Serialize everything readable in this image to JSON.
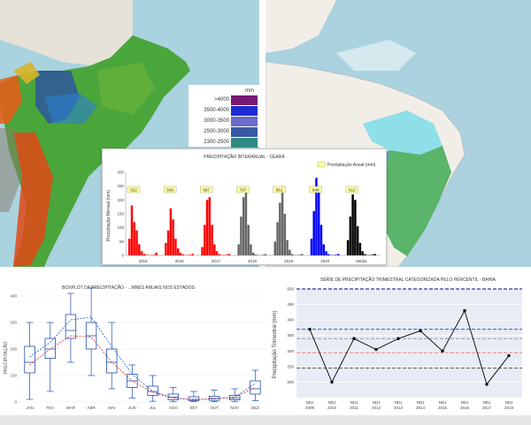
{
  "map_left": {
    "legend_unit": "mm",
    "legend": [
      {
        "label": ">4000",
        "color": "#7a1a73"
      },
      {
        "label": "3500-4000",
        "color": "#1d2bd1"
      },
      {
        "label": "3000-3500",
        "color": "#6a6ccc"
      },
      {
        "label": "2500-3000",
        "color": "#3a59a5"
      },
      {
        "label": "2300-2500",
        "color": "#2e8a80"
      }
    ]
  },
  "chart_data": [
    {
      "type": "bar",
      "title": "PRECIPITAÇÃO INTERANUAL - CEARÁ",
      "ylabel": "Precipitação Mensal (mm)",
      "legend": "Precipitação Anual (mm)",
      "ylim": [
        0,
        300
      ],
      "yticks": [
        0,
        50,
        100,
        150,
        200,
        250,
        300
      ],
      "groups": [
        {
          "label": "2016",
          "annual": "522",
          "color": "#ff0000",
          "values": [
            60,
            180,
            120,
            90,
            40,
            15,
            5,
            2,
            1,
            1,
            2,
            10
          ]
        },
        {
          "label": "2016",
          "annual": "549",
          "color": "#ff0000",
          "values": [
            45,
            90,
            170,
            130,
            60,
            25,
            10,
            3,
            1,
            1,
            2,
            5
          ]
        },
        {
          "label": "2017",
          "annual": "667",
          "color": "#ff0000",
          "values": [
            30,
            110,
            200,
            210,
            110,
            40,
            15,
            4,
            1,
            1,
            2,
            5
          ]
        },
        {
          "label": "2018",
          "annual": "797",
          "color": "#666666",
          "values": [
            40,
            140,
            210,
            240,
            110,
            40,
            10,
            3,
            1,
            1,
            2,
            5
          ]
        },
        {
          "label": "2019",
          "annual": "861",
          "color": "#666666",
          "values": [
            50,
            120,
            190,
            250,
            150,
            55,
            20,
            5,
            1,
            1,
            2,
            5
          ]
        },
        {
          "label": "2020",
          "annual": "849",
          "color": "#0000ff",
          "values": [
            60,
            160,
            280,
            230,
            110,
            40,
            15,
            4,
            1,
            1,
            2,
            5
          ]
        },
        {
          "label": "Média",
          "annual": "812",
          "color": "#000000",
          "values": [
            55,
            140,
            220,
            200,
            105,
            45,
            15,
            4,
            1,
            1,
            2,
            5
          ]
        }
      ]
    },
    {
      "type": "box",
      "title": "BOXPLOT DA PRECIPITAÇÃO - ...MNES ANUAIS NOS ESTADOS",
      "ylabel": "PRECIPITAÇÃO",
      "ylim": [
        0,
        400
      ],
      "yticks": [
        0,
        100,
        200,
        300,
        400
      ],
      "categories": [
        "JAN",
        "FEV",
        "MAR",
        "ABR",
        "MAI",
        "JUN",
        "JUL",
        "AGO",
        "SET",
        "OUT",
        "NOV",
        "DEZ"
      ],
      "boxes": [
        {
          "min": 10,
          "q1": 110,
          "median": 150,
          "q3": 210,
          "max": 300
        },
        {
          "min": 40,
          "q1": 165,
          "median": 200,
          "q3": 240,
          "max": 300
        },
        {
          "min": 150,
          "q1": 240,
          "median": 270,
          "q3": 330,
          "max": 410
        },
        {
          "min": 100,
          "q1": 200,
          "median": 250,
          "q3": 300,
          "max": 430
        },
        {
          "min": 50,
          "q1": 110,
          "median": 150,
          "q3": 200,
          "max": 300
        },
        {
          "min": 15,
          "q1": 55,
          "median": 80,
          "q3": 105,
          "max": 140
        },
        {
          "min": 3,
          "q1": 25,
          "median": 40,
          "q3": 60,
          "max": 100
        },
        {
          "min": 1,
          "q1": 8,
          "median": 18,
          "q3": 30,
          "max": 55
        },
        {
          "min": 1,
          "q1": 5,
          "median": 10,
          "q3": 20,
          "max": 40
        },
        {
          "min": 1,
          "q1": 6,
          "median": 14,
          "q3": 22,
          "max": 45
        },
        {
          "min": 1,
          "q1": 8,
          "median": 14,
          "q3": 25,
          "max": 50
        },
        {
          "min": 5,
          "q1": 30,
          "median": 50,
          "q3": 80,
          "max": 120
        }
      ],
      "series": [
        {
          "color": "#1a5fd1",
          "values": [
            170,
            225,
            310,
            320,
            210,
            105,
            40,
            15,
            8,
            12,
            18,
            70
          ]
        },
        {
          "color": "#d12a2a",
          "values": [
            140,
            200,
            250,
            245,
            150,
            80,
            35,
            15,
            9,
            12,
            18,
            55
          ]
        }
      ]
    },
    {
      "type": "line",
      "title": "SÉRIE DE PRECIPITAÇÃO TRIMESTRAL CATEGORIZADA PELO PERCENTIL - BAHIA",
      "ylabel": "Precipitação Trimestral (mm)",
      "ylim": [
        150,
        500
      ],
      "yticks": [
        200,
        250,
        300,
        350,
        400,
        450,
        500
      ],
      "x": [
        "NDJ 2009",
        "NDJ 2010",
        "NDJ 2011",
        "NDJ 2012",
        "NDJ 2013",
        "NDJ 2014",
        "NDJ 2015",
        "NDJ 2016",
        "NDJ 2017",
        "NDJ 2018"
      ],
      "values": [
        370,
        200,
        340,
        305,
        340,
        365,
        300,
        430,
        193,
        285
      ],
      "thresholds": [
        {
          "value": 500,
          "color": "#00008b"
        },
        {
          "value": 370,
          "color": "#1f3fe0"
        },
        {
          "value": 340,
          "color": "#8888aa"
        },
        {
          "value": 295,
          "color": "#ff6666"
        },
        {
          "value": 245,
          "color": "#555555"
        }
      ]
    }
  ]
}
